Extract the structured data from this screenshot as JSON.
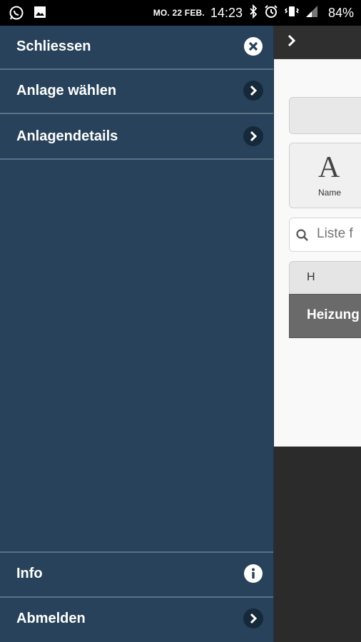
{
  "status_bar": {
    "date": "MO. 22 FEB.",
    "time": "14:23",
    "battery": "84%",
    "icons_left": [
      "whatsapp-icon",
      "image-icon"
    ],
    "icons_right": [
      "bluetooth-icon",
      "alarm-icon",
      "vibrate-icon",
      "signal-icon",
      "battery-icon"
    ]
  },
  "drawer": {
    "close_label": "Schliessen",
    "items": [
      {
        "label": "Anlage wählen",
        "icon": "chevron-right-icon"
      },
      {
        "label": "Anlagendetails",
        "icon": "chevron-right-icon"
      }
    ],
    "bottom_items": [
      {
        "label": "Info",
        "icon": "info-icon"
      },
      {
        "label": "Abmelden",
        "icon": "chevron-right-icon"
      }
    ]
  },
  "background_app": {
    "sort_option_glyph": "A",
    "sort_option_label": "Name",
    "search_placeholder": "Liste f",
    "list_group_header": "H",
    "list_item": "Heizung"
  },
  "colors": {
    "drawer_bg": "#27425a",
    "divider": "#5b7184",
    "icon_circle": "#16293a"
  }
}
